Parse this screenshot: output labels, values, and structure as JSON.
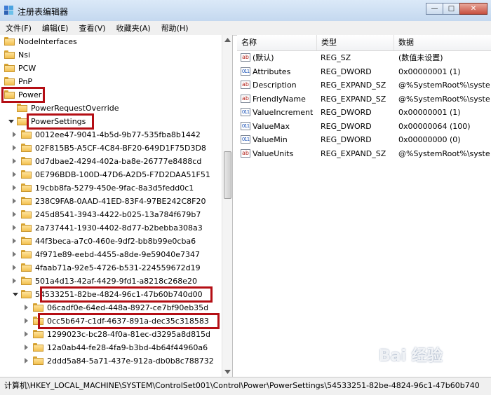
{
  "window": {
    "title": "注册表编辑器"
  },
  "menu": [
    "文件(F)",
    "编辑(E)",
    "查看(V)",
    "收藏夹(A)",
    "帮助(H)"
  ],
  "tree": [
    {
      "label": "NodeInterfaces",
      "indent": 0,
      "expander": "none",
      "highlight": false
    },
    {
      "label": "Nsi",
      "indent": 0,
      "expander": "none",
      "highlight": false
    },
    {
      "label": "PCW",
      "indent": 0,
      "expander": "none",
      "highlight": false
    },
    {
      "label": "PnP",
      "indent": 0,
      "expander": "none",
      "highlight": false
    },
    {
      "label": "Power",
      "indent": 0,
      "expander": "none",
      "highlight": true
    },
    {
      "label": "PowerRequestOverride",
      "indent": 1,
      "expander": "none",
      "highlight": false
    },
    {
      "label": "PowerSettings",
      "indent": 1,
      "expander": "open",
      "highlight": true
    },
    {
      "label": "0012ee47-9041-4b5d-9b77-535fba8b1442",
      "indent": 2,
      "expander": "closed",
      "highlight": false
    },
    {
      "label": "02F815B5-A5CF-4C84-BF20-649D1F75D3D8",
      "indent": 2,
      "expander": "closed",
      "highlight": false
    },
    {
      "label": "0d7dbae2-4294-402a-ba8e-26777e8488cd",
      "indent": 2,
      "expander": "closed",
      "highlight": false
    },
    {
      "label": "0E796BDB-100D-47D6-A2D5-F7D2DAA51F51",
      "indent": 2,
      "expander": "closed",
      "highlight": false
    },
    {
      "label": "19cbb8fa-5279-450e-9fac-8a3d5fedd0c1",
      "indent": 2,
      "expander": "closed",
      "highlight": false
    },
    {
      "label": "238C9FA8-0AAD-41ED-83F4-97BE242C8F20",
      "indent": 2,
      "expander": "closed",
      "highlight": false
    },
    {
      "label": "245d8541-3943-4422-b025-13a784f679b7",
      "indent": 2,
      "expander": "closed",
      "highlight": false
    },
    {
      "label": "2a737441-1930-4402-8d77-b2bebba308a3",
      "indent": 2,
      "expander": "closed",
      "highlight": false
    },
    {
      "label": "44f3beca-a7c0-460e-9df2-bb8b99e0cba6",
      "indent": 2,
      "expander": "closed",
      "highlight": false
    },
    {
      "label": "4f971e89-eebd-4455-a8de-9e59040e7347",
      "indent": 2,
      "expander": "closed",
      "highlight": false
    },
    {
      "label": "4faab71a-92e5-4726-b531-224559672d19",
      "indent": 2,
      "expander": "closed",
      "highlight": false
    },
    {
      "label": "501a4d13-42af-4429-9fd1-a8218c268e20",
      "indent": 2,
      "expander": "closed",
      "highlight": false
    },
    {
      "label": "54533251-82be-4824-96c1-47b60b740d00",
      "indent": 2,
      "expander": "open",
      "highlight": true
    },
    {
      "label": "06cadf0e-64ed-448a-8927-ce7bf90eb35d",
      "indent": 3,
      "expander": "closed",
      "highlight": false
    },
    {
      "label": "0cc5b647-c1df-4637-891a-dec35c318583",
      "indent": 3,
      "expander": "closed",
      "highlight": true
    },
    {
      "label": "1299023c-bc28-4f0a-81ec-d3295a8d815d",
      "indent": 3,
      "expander": "closed",
      "highlight": false
    },
    {
      "label": "12a0ab44-fe28-4fa9-b3bd-4b64f44960a6",
      "indent": 3,
      "expander": "closed",
      "highlight": false
    },
    {
      "label": "2ddd5a84-5a71-437e-912a-db0b8c788732",
      "indent": 3,
      "expander": "closed",
      "highlight": false
    }
  ],
  "list": {
    "headers": {
      "name": "名称",
      "type": "类型",
      "data": "数据"
    },
    "rows": [
      {
        "icon": "string-value-icon",
        "name": "(默认)",
        "type": "REG_SZ",
        "data": "(数值未设置)"
      },
      {
        "icon": "binary-value-icon",
        "name": "Attributes",
        "type": "REG_DWORD",
        "data": "0x00000001 (1)"
      },
      {
        "icon": "string-value-icon",
        "name": "Description",
        "type": "REG_EXPAND_SZ",
        "data": "@%SystemRoot%\\syste"
      },
      {
        "icon": "string-value-icon",
        "name": "FriendlyName",
        "type": "REG_EXPAND_SZ",
        "data": "@%SystemRoot%\\syste"
      },
      {
        "icon": "binary-value-icon",
        "name": "ValueIncrement",
        "type": "REG_DWORD",
        "data": "0x00000001 (1)"
      },
      {
        "icon": "binary-value-icon",
        "name": "ValueMax",
        "type": "REG_DWORD",
        "data": "0x00000064 (100)"
      },
      {
        "icon": "binary-value-icon",
        "name": "ValueMin",
        "type": "REG_DWORD",
        "data": "0x00000000 (0)"
      },
      {
        "icon": "string-value-icon",
        "name": "ValueUnits",
        "type": "REG_EXPAND_SZ",
        "data": "@%SystemRoot%\\syste"
      }
    ]
  },
  "statusbar": {
    "path": "计算机\\HKEY_LOCAL_MACHINE\\SYSTEM\\ControlSet001\\Control\\Power\\PowerSettings\\54533251-82be-4824-96c1-47b60b740"
  },
  "watermark": {
    "text": "Bai 经验"
  },
  "colors": {
    "highlight": "#b40e14",
    "folder": "#f2c04f"
  }
}
